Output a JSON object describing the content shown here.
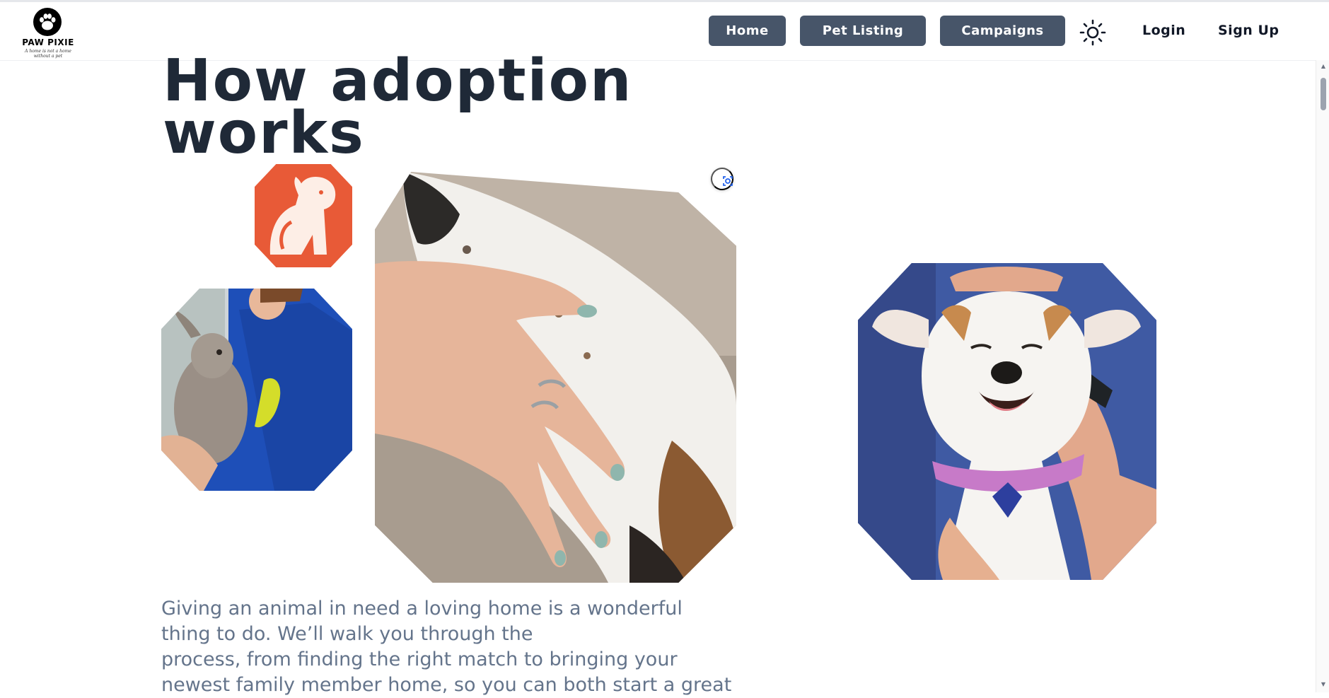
{
  "brand": {
    "name": "PAW PIXIE",
    "tagline": "A home is not a home without a pet",
    "logo_icon": "paw-icon"
  },
  "nav": {
    "home_label": "Home",
    "pet_listing_label": "Pet Listing",
    "campaigns_label": "Campaigns",
    "theme_toggle_icon": "sun-icon",
    "login_label": "Login",
    "signup_label": "Sign Up"
  },
  "main": {
    "title_line1": "How adoption",
    "title_line2": "works",
    "description_line1": "Giving an animal in need a loving home is a wonderful",
    "description_line2": "thing to do. We’ll walk you through the",
    "description_line3": "process, from finding the right match to bringing your",
    "description_line4": "newest family member home, so you can both start a great"
  },
  "images": {
    "badge": "dog-logo-badge",
    "photo_1": "rabbit-held-photo",
    "photo_2": "hand-on-dog-photo",
    "photo_3": "happy-dog-photo",
    "lens_icon": "visual-search-icon"
  },
  "colors": {
    "nav_button": "#475569",
    "title": "#1f2937",
    "description": "#64748b",
    "badge_orange": "#e85a37"
  }
}
